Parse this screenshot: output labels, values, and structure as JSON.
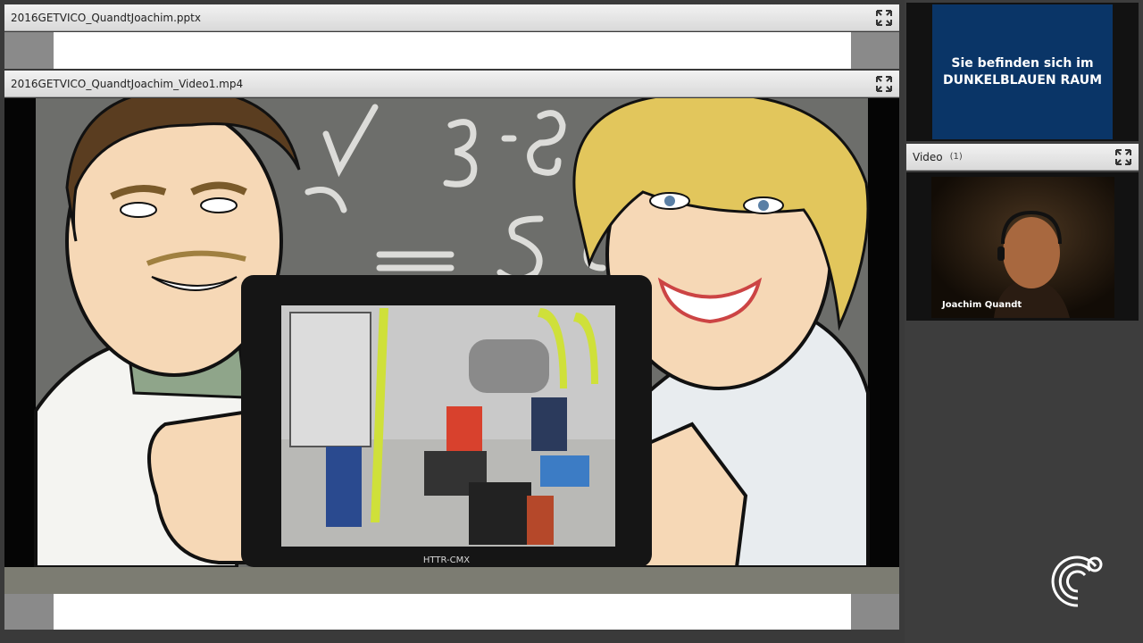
{
  "document_pod": {
    "title": "2016GETVICO_QuandtJoachim.pptx"
  },
  "video_pod": {
    "title": "2016GETVICO_QuandtJoachim_Video1.mp4",
    "frame_caption": "HTTR-CMX"
  },
  "room_banner": {
    "line1": "Sie befinden sich im",
    "line2": "DUNKELBLAUEN RAUM"
  },
  "camera_pod": {
    "title": "Video",
    "count": "(1)",
    "participant_name": "Joachim Quandt"
  },
  "icons": {
    "expand": "expand-arrows-icon",
    "logo": "goethe-logo-icon"
  },
  "colors": {
    "banner_bg": "#0a3567",
    "header_bg": "#e6e6e6",
    "app_bg": "#3a3a3a"
  }
}
